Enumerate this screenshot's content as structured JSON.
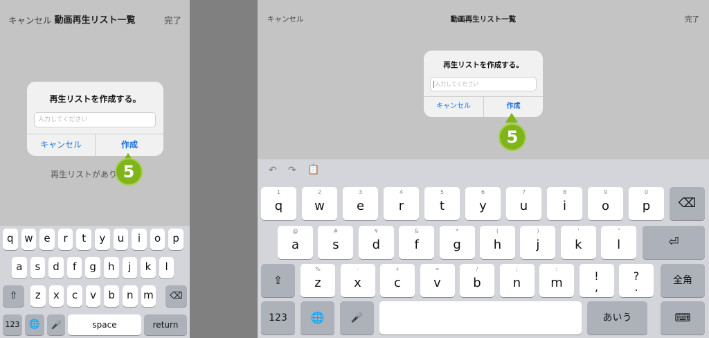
{
  "phone": {
    "nav": {
      "cancel": "キャンセル",
      "title": "動画再生リスト一覧",
      "done": "完了"
    },
    "alert": {
      "title": "再生リストを作成する。",
      "placeholder": "入力してください",
      "cancel": "キャンセル",
      "create": "作成"
    },
    "empty_message": "再生リストがあり",
    "badge": "5",
    "keyboard": {
      "row1": [
        "q",
        "w",
        "e",
        "r",
        "t",
        "y",
        "u",
        "i",
        "o",
        "p"
      ],
      "row2": [
        "a",
        "s",
        "d",
        "f",
        "g",
        "h",
        "j",
        "k",
        "l"
      ],
      "row3": [
        "z",
        "x",
        "c",
        "v",
        "b",
        "n",
        "m"
      ],
      "numbers_key": "123",
      "space_key": "space",
      "return_key": "return"
    }
  },
  "tablet": {
    "nav": {
      "cancel": "キャンセル",
      "title": "動画再生リスト一覧",
      "done": "完了"
    },
    "alert": {
      "title": "再生リストを作成する。",
      "placeholder": "入力してください",
      "cancel": "キャンセル",
      "create": "作成"
    },
    "badge": "5",
    "keyboard": {
      "row1": [
        {
          "main": "q",
          "hint": "1"
        },
        {
          "main": "w",
          "hint": "2"
        },
        {
          "main": "e",
          "hint": "3"
        },
        {
          "main": "r",
          "hint": "4"
        },
        {
          "main": "t",
          "hint": "5"
        },
        {
          "main": "y",
          "hint": "6"
        },
        {
          "main": "u",
          "hint": "7"
        },
        {
          "main": "i",
          "hint": "8"
        },
        {
          "main": "o",
          "hint": "9"
        },
        {
          "main": "p",
          "hint": "0"
        }
      ],
      "row2": [
        {
          "main": "a",
          "hint": "@"
        },
        {
          "main": "s",
          "hint": "#"
        },
        {
          "main": "d",
          "hint": "¥"
        },
        {
          "main": "f",
          "hint": "&"
        },
        {
          "main": "g",
          "hint": "*"
        },
        {
          "main": "h",
          "hint": "("
        },
        {
          "main": "j",
          "hint": ")"
        },
        {
          "main": "k",
          "hint": "'"
        },
        {
          "main": "l",
          "hint": "\""
        }
      ],
      "row3": [
        {
          "main": "z",
          "hint": "%"
        },
        {
          "main": "x",
          "hint": "-"
        },
        {
          "main": "c",
          "hint": "+"
        },
        {
          "main": "v",
          "hint": "="
        },
        {
          "main": "b",
          "hint": "/"
        },
        {
          "main": "n",
          "hint": ";"
        },
        {
          "main": "m",
          "hint": ":"
        },
        {
          "main": "!",
          "hint": ""
        },
        {
          "main": "?",
          "hint": ""
        }
      ],
      "row3_extra": [
        ",",
        "."
      ],
      "zenkaku_key": "全角",
      "numbers_key": "123",
      "aiu_key": "あいう"
    }
  },
  "colors": {
    "accent": "#1a73d8",
    "badge": "#7fb51a",
    "divider": "#808080"
  }
}
